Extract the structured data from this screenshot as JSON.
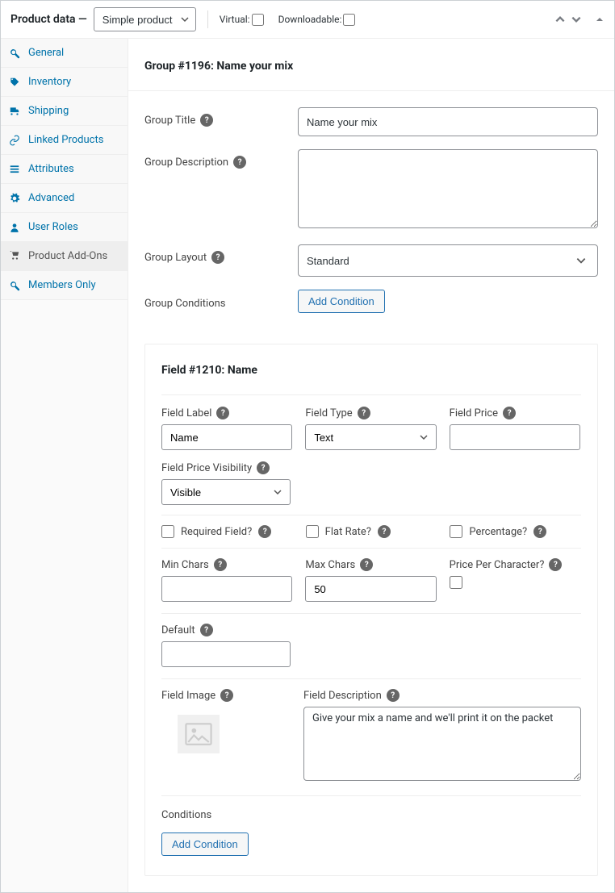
{
  "header": {
    "title": "Product data —",
    "product_type": "Simple product",
    "virtual_label": "Virtual:",
    "downloadable_label": "Downloadable:"
  },
  "sidebar": {
    "items": [
      {
        "label": "General"
      },
      {
        "label": "Inventory"
      },
      {
        "label": "Shipping"
      },
      {
        "label": "Linked Products"
      },
      {
        "label": "Attributes"
      },
      {
        "label": "Advanced"
      },
      {
        "label": "User Roles"
      },
      {
        "label": "Product Add-Ons"
      },
      {
        "label": "Members Only"
      }
    ]
  },
  "group": {
    "heading": "Group #1196: Name your mix",
    "title_label": "Group Title",
    "title_value": "Name your mix",
    "description_label": "Group Description",
    "description_value": "",
    "layout_label": "Group Layout",
    "layout_value": "Standard",
    "conditions_label": "Group Conditions",
    "add_condition_btn": "Add Condition"
  },
  "field": {
    "heading": "Field #1210: Name",
    "label_label": "Field Label",
    "label_value": "Name",
    "type_label": "Field Type",
    "type_value": "Text",
    "price_label": "Field Price",
    "price_value": "",
    "price_visibility_label": "Field Price Visibility",
    "price_visibility_value": "Visible",
    "required_label": "Required Field?",
    "flat_rate_label": "Flat Rate?",
    "percentage_label": "Percentage?",
    "min_chars_label": "Min Chars",
    "min_chars_value": "",
    "max_chars_label": "Max Chars",
    "max_chars_value": "50",
    "ppc_label": "Price Per Character?",
    "default_label": "Default",
    "default_value": "",
    "image_label": "Field Image",
    "description_label": "Field Description",
    "description_value": "Give your mix a name and we'll print it on the packet",
    "conditions_label": "Conditions",
    "add_condition_btn": "Add Condition"
  }
}
